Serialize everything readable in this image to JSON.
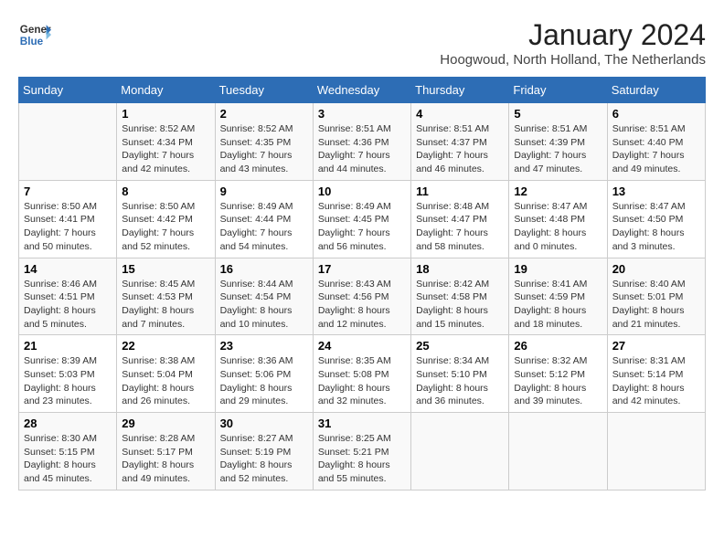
{
  "header": {
    "logo_line1": "General",
    "logo_line2": "Blue",
    "title": "January 2024",
    "subtitle": "Hoogwoud, North Holland, The Netherlands"
  },
  "weekdays": [
    "Sunday",
    "Monday",
    "Tuesday",
    "Wednesday",
    "Thursday",
    "Friday",
    "Saturday"
  ],
  "weeks": [
    [
      {
        "day": "",
        "sunrise": "",
        "sunset": "",
        "daylight": ""
      },
      {
        "day": "1",
        "sunrise": "Sunrise: 8:52 AM",
        "sunset": "Sunset: 4:34 PM",
        "daylight": "Daylight: 7 hours and 42 minutes."
      },
      {
        "day": "2",
        "sunrise": "Sunrise: 8:52 AM",
        "sunset": "Sunset: 4:35 PM",
        "daylight": "Daylight: 7 hours and 43 minutes."
      },
      {
        "day": "3",
        "sunrise": "Sunrise: 8:51 AM",
        "sunset": "Sunset: 4:36 PM",
        "daylight": "Daylight: 7 hours and 44 minutes."
      },
      {
        "day": "4",
        "sunrise": "Sunrise: 8:51 AM",
        "sunset": "Sunset: 4:37 PM",
        "daylight": "Daylight: 7 hours and 46 minutes."
      },
      {
        "day": "5",
        "sunrise": "Sunrise: 8:51 AM",
        "sunset": "Sunset: 4:39 PM",
        "daylight": "Daylight: 7 hours and 47 minutes."
      },
      {
        "day": "6",
        "sunrise": "Sunrise: 8:51 AM",
        "sunset": "Sunset: 4:40 PM",
        "daylight": "Daylight: 7 hours and 49 minutes."
      }
    ],
    [
      {
        "day": "7",
        "sunrise": "Sunrise: 8:50 AM",
        "sunset": "Sunset: 4:41 PM",
        "daylight": "Daylight: 7 hours and 50 minutes."
      },
      {
        "day": "8",
        "sunrise": "Sunrise: 8:50 AM",
        "sunset": "Sunset: 4:42 PM",
        "daylight": "Daylight: 7 hours and 52 minutes."
      },
      {
        "day": "9",
        "sunrise": "Sunrise: 8:49 AM",
        "sunset": "Sunset: 4:44 PM",
        "daylight": "Daylight: 7 hours and 54 minutes."
      },
      {
        "day": "10",
        "sunrise": "Sunrise: 8:49 AM",
        "sunset": "Sunset: 4:45 PM",
        "daylight": "Daylight: 7 hours and 56 minutes."
      },
      {
        "day": "11",
        "sunrise": "Sunrise: 8:48 AM",
        "sunset": "Sunset: 4:47 PM",
        "daylight": "Daylight: 7 hours and 58 minutes."
      },
      {
        "day": "12",
        "sunrise": "Sunrise: 8:47 AM",
        "sunset": "Sunset: 4:48 PM",
        "daylight": "Daylight: 8 hours and 0 minutes."
      },
      {
        "day": "13",
        "sunrise": "Sunrise: 8:47 AM",
        "sunset": "Sunset: 4:50 PM",
        "daylight": "Daylight: 8 hours and 3 minutes."
      }
    ],
    [
      {
        "day": "14",
        "sunrise": "Sunrise: 8:46 AM",
        "sunset": "Sunset: 4:51 PM",
        "daylight": "Daylight: 8 hours and 5 minutes."
      },
      {
        "day": "15",
        "sunrise": "Sunrise: 8:45 AM",
        "sunset": "Sunset: 4:53 PM",
        "daylight": "Daylight: 8 hours and 7 minutes."
      },
      {
        "day": "16",
        "sunrise": "Sunrise: 8:44 AM",
        "sunset": "Sunset: 4:54 PM",
        "daylight": "Daylight: 8 hours and 10 minutes."
      },
      {
        "day": "17",
        "sunrise": "Sunrise: 8:43 AM",
        "sunset": "Sunset: 4:56 PM",
        "daylight": "Daylight: 8 hours and 12 minutes."
      },
      {
        "day": "18",
        "sunrise": "Sunrise: 8:42 AM",
        "sunset": "Sunset: 4:58 PM",
        "daylight": "Daylight: 8 hours and 15 minutes."
      },
      {
        "day": "19",
        "sunrise": "Sunrise: 8:41 AM",
        "sunset": "Sunset: 4:59 PM",
        "daylight": "Daylight: 8 hours and 18 minutes."
      },
      {
        "day": "20",
        "sunrise": "Sunrise: 8:40 AM",
        "sunset": "Sunset: 5:01 PM",
        "daylight": "Daylight: 8 hours and 21 minutes."
      }
    ],
    [
      {
        "day": "21",
        "sunrise": "Sunrise: 8:39 AM",
        "sunset": "Sunset: 5:03 PM",
        "daylight": "Daylight: 8 hours and 23 minutes."
      },
      {
        "day": "22",
        "sunrise": "Sunrise: 8:38 AM",
        "sunset": "Sunset: 5:04 PM",
        "daylight": "Daylight: 8 hours and 26 minutes."
      },
      {
        "day": "23",
        "sunrise": "Sunrise: 8:36 AM",
        "sunset": "Sunset: 5:06 PM",
        "daylight": "Daylight: 8 hours and 29 minutes."
      },
      {
        "day": "24",
        "sunrise": "Sunrise: 8:35 AM",
        "sunset": "Sunset: 5:08 PM",
        "daylight": "Daylight: 8 hours and 32 minutes."
      },
      {
        "day": "25",
        "sunrise": "Sunrise: 8:34 AM",
        "sunset": "Sunset: 5:10 PM",
        "daylight": "Daylight: 8 hours and 36 minutes."
      },
      {
        "day": "26",
        "sunrise": "Sunrise: 8:32 AM",
        "sunset": "Sunset: 5:12 PM",
        "daylight": "Daylight: 8 hours and 39 minutes."
      },
      {
        "day": "27",
        "sunrise": "Sunrise: 8:31 AM",
        "sunset": "Sunset: 5:14 PM",
        "daylight": "Daylight: 8 hours and 42 minutes."
      }
    ],
    [
      {
        "day": "28",
        "sunrise": "Sunrise: 8:30 AM",
        "sunset": "Sunset: 5:15 PM",
        "daylight": "Daylight: 8 hours and 45 minutes."
      },
      {
        "day": "29",
        "sunrise": "Sunrise: 8:28 AM",
        "sunset": "Sunset: 5:17 PM",
        "daylight": "Daylight: 8 hours and 49 minutes."
      },
      {
        "day": "30",
        "sunrise": "Sunrise: 8:27 AM",
        "sunset": "Sunset: 5:19 PM",
        "daylight": "Daylight: 8 hours and 52 minutes."
      },
      {
        "day": "31",
        "sunrise": "Sunrise: 8:25 AM",
        "sunset": "Sunset: 5:21 PM",
        "daylight": "Daylight: 8 hours and 55 minutes."
      },
      {
        "day": "",
        "sunrise": "",
        "sunset": "",
        "daylight": ""
      },
      {
        "day": "",
        "sunrise": "",
        "sunset": "",
        "daylight": ""
      },
      {
        "day": "",
        "sunrise": "",
        "sunset": "",
        "daylight": ""
      }
    ]
  ]
}
